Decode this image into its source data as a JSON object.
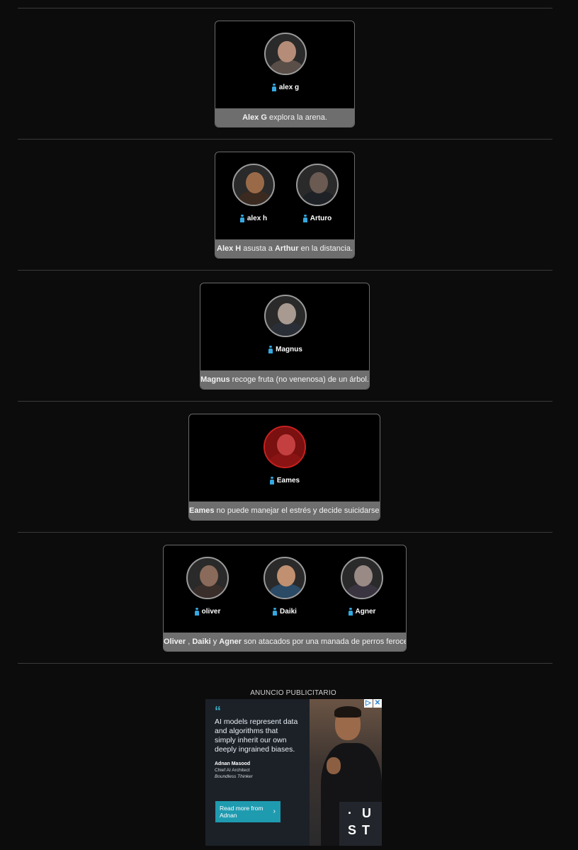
{
  "events": [
    {
      "tributes": [
        {
          "name": "alex g",
          "avatar_tone": "#b58c78",
          "body_tone": "#5a4e48"
        }
      ],
      "caption_parts": [
        {
          "text": "Alex G",
          "bold": true
        },
        {
          "text": " explora la arena.",
          "bold": false
        }
      ]
    },
    {
      "tributes": [
        {
          "name": "alex h",
          "avatar_tone": "#9a6a48",
          "body_tone": "#3a2a20"
        },
        {
          "name": "Arturo",
          "avatar_tone": "#6a5a52",
          "body_tone": "#1e2226"
        }
      ],
      "caption_parts": [
        {
          "text": "Alex H",
          "bold": true
        },
        {
          "text": " asusta a ",
          "bold": false
        },
        {
          "text": "Arthur",
          "bold": true
        },
        {
          "text": " en la distancia.",
          "bold": false
        }
      ]
    },
    {
      "tributes": [
        {
          "name": "Magnus",
          "avatar_tone": "#a89a90",
          "body_tone": "#2a2e36"
        }
      ],
      "caption_parts": [
        {
          "text": "Magnus",
          "bold": true
        },
        {
          "text": " recoge fruta (no venenosa) de un árbol.",
          "bold": false
        }
      ]
    },
    {
      "tributes": [
        {
          "name": "Eames",
          "avatar_tone": "#c44040",
          "body_tone": "#8a1414",
          "dead": true
        }
      ],
      "caption_parts": [
        {
          "text": "Eames",
          "bold": true
        },
        {
          "text": " no puede manejar el estrés y decide suicidarse.",
          "bold": false
        }
      ]
    },
    {
      "tributes": [
        {
          "name": "oliver",
          "avatar_tone": "#8a6a5a",
          "body_tone": "#3a2e2a"
        },
        {
          "name": "Daiki",
          "avatar_tone": "#c09070",
          "body_tone": "#2a4a66"
        },
        {
          "name": "Agner",
          "avatar_tone": "#9a8a86",
          "body_tone": "#3a3440"
        }
      ],
      "caption_parts": [
        {
          "text": "Oliver",
          "bold": true
        },
        {
          "text": " , ",
          "bold": false
        },
        {
          "text": "Daiki",
          "bold": true
        },
        {
          "text": " y ",
          "bold": false
        },
        {
          "text": "Agner",
          "bold": true
        },
        {
          "text": " son atacados por una manada de perros feroces.",
          "bold": false
        }
      ]
    }
  ],
  "ad": {
    "label": "ANUNCIO PUBLICITARIO",
    "quote_mark": "“",
    "quote": "AI models represent data and algorithms that simply inherit our own deeply ingrained biases.",
    "author": "Adnan Masood",
    "role": "Chief AI Architect",
    "tagline": "Boundless Thinker",
    "cta": "Read more from Adnan",
    "cta_icon": "chevron-right-icon",
    "logo_letters": [
      "·",
      "U",
      "S",
      "T"
    ],
    "choices_icons": [
      "ad-choices-icon",
      "close-icon"
    ]
  }
}
